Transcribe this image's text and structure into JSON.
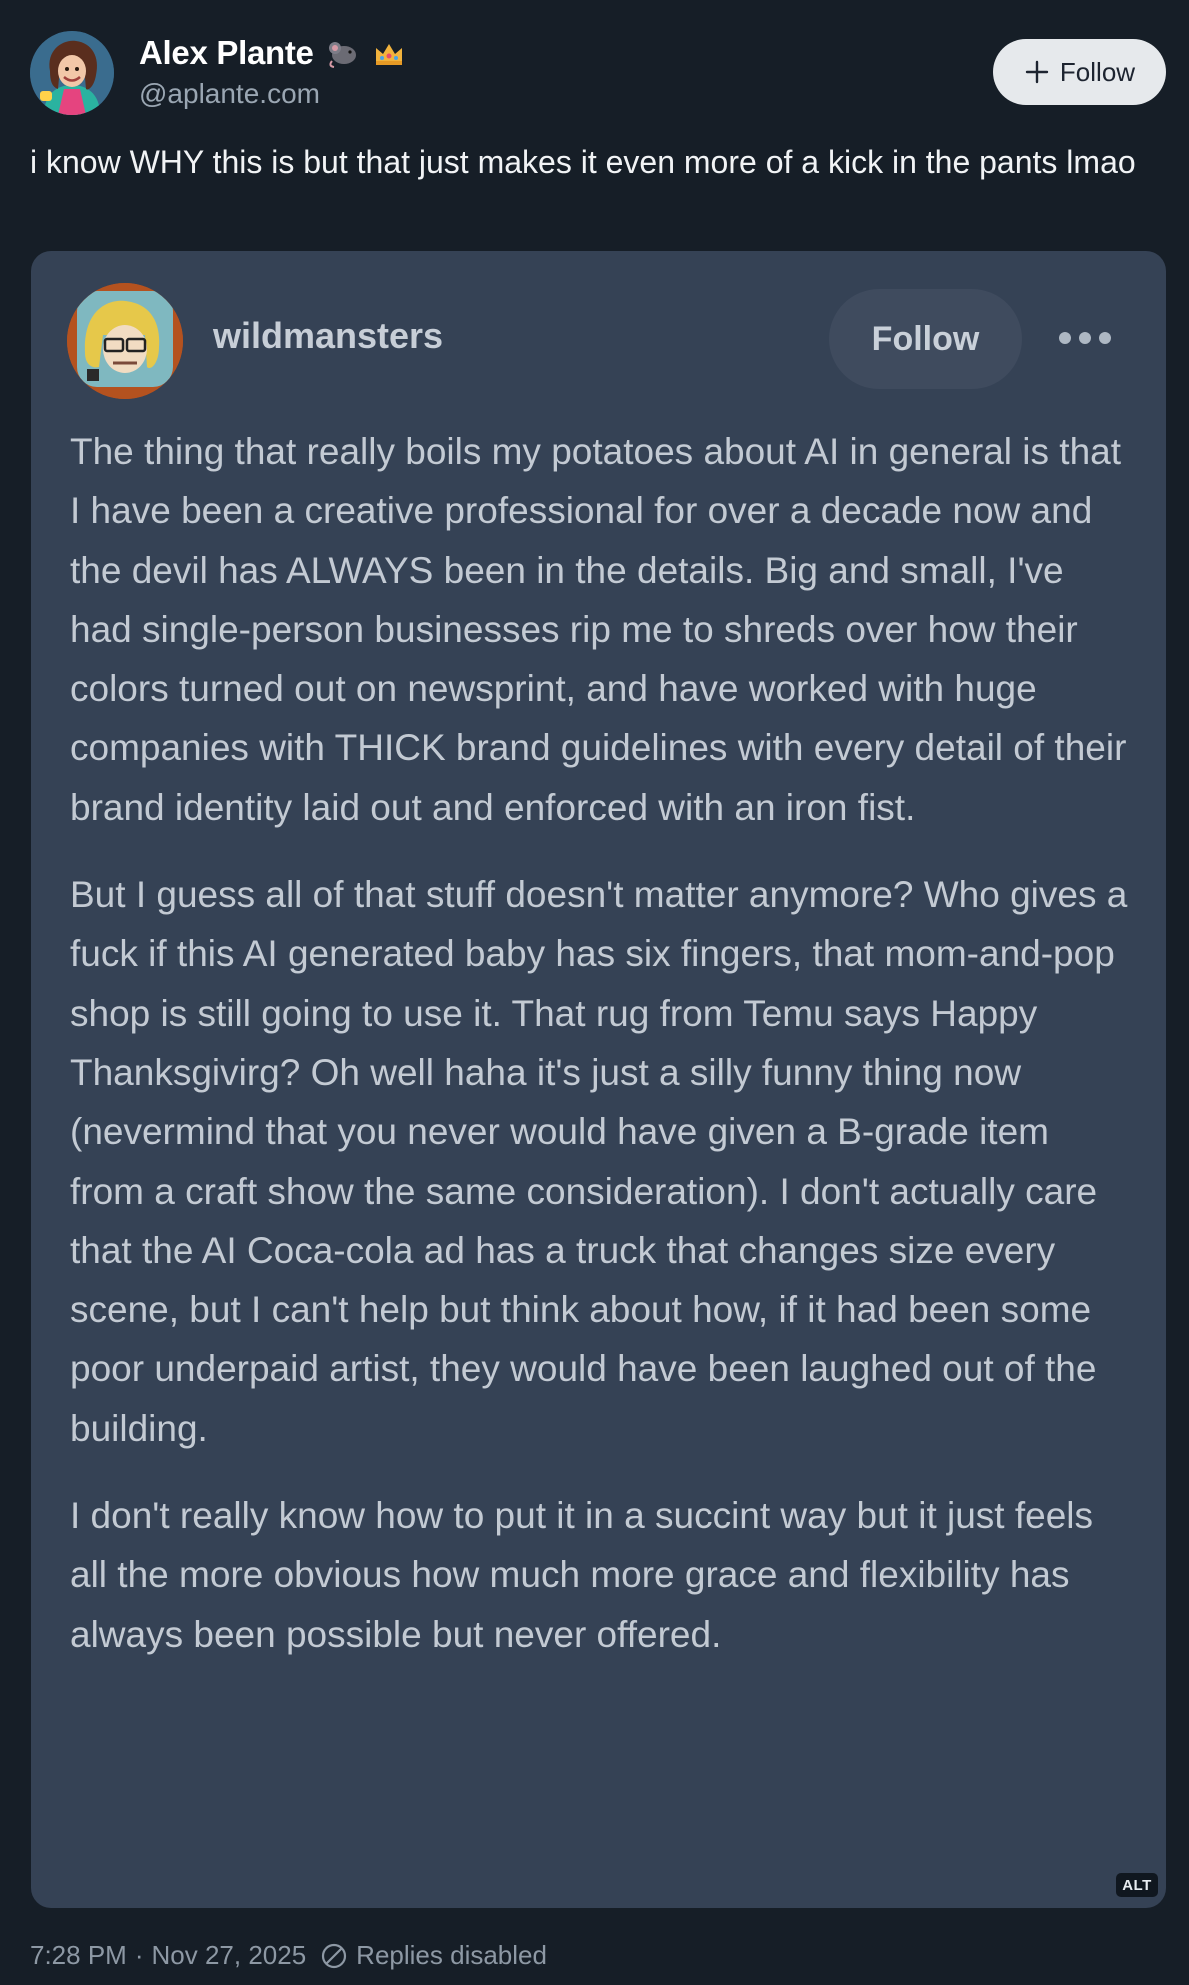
{
  "author": {
    "display_name": "Alex Plante",
    "handle": "@aplante.com",
    "badges": [
      "rat-emoji",
      "crown-emoji"
    ],
    "follow_label": "Follow"
  },
  "post": {
    "text": "i know WHY this is but that just makes it even more of a kick in the pants lmao"
  },
  "embed": {
    "username": "wildmansters",
    "follow_label": "Follow",
    "more_icon": "more-dots-icon",
    "paragraphs": [
      "The thing that really boils my potatoes about AI in general is that I have been a creative professional for over a decade now and the devil has ALWAYS been in the details. Big and small, I've had single-person businesses rip me to shreds over how their colors turned out on newsprint, and have worked with huge companies with THICK brand guidelines with every detail of their brand identity laid out and enforced with an iron fist.",
      "But I guess all of that stuff doesn't matter anymore? Who gives a fuck if this AI generated baby has six fingers, that mom-and-pop shop is still going to use it. That rug from Temu says Happy Thanksgivirg? Oh well haha it's just a silly funny thing now (nevermind that you never would have given a B-grade item from a craft show the same consideration). I don't actually care that the AI Coca-cola ad has a truck that changes size every scene, but I can't help but think about how, if it had been some poor underpaid artist, they would have been laughed out of the building.",
      "I don't really know how to put it in a succint way but it just feels all the more obvious how much more grace and flexibility has always been possible but never offered."
    ],
    "alt_label": "ALT"
  },
  "footer": {
    "time": "7:28 PM",
    "separator": "·",
    "date": "Nov 27, 2025",
    "replies_status": "Replies disabled"
  },
  "colors": {
    "background": "#161e27",
    "card": "#354255",
    "muted_text": "#8d98a4"
  }
}
